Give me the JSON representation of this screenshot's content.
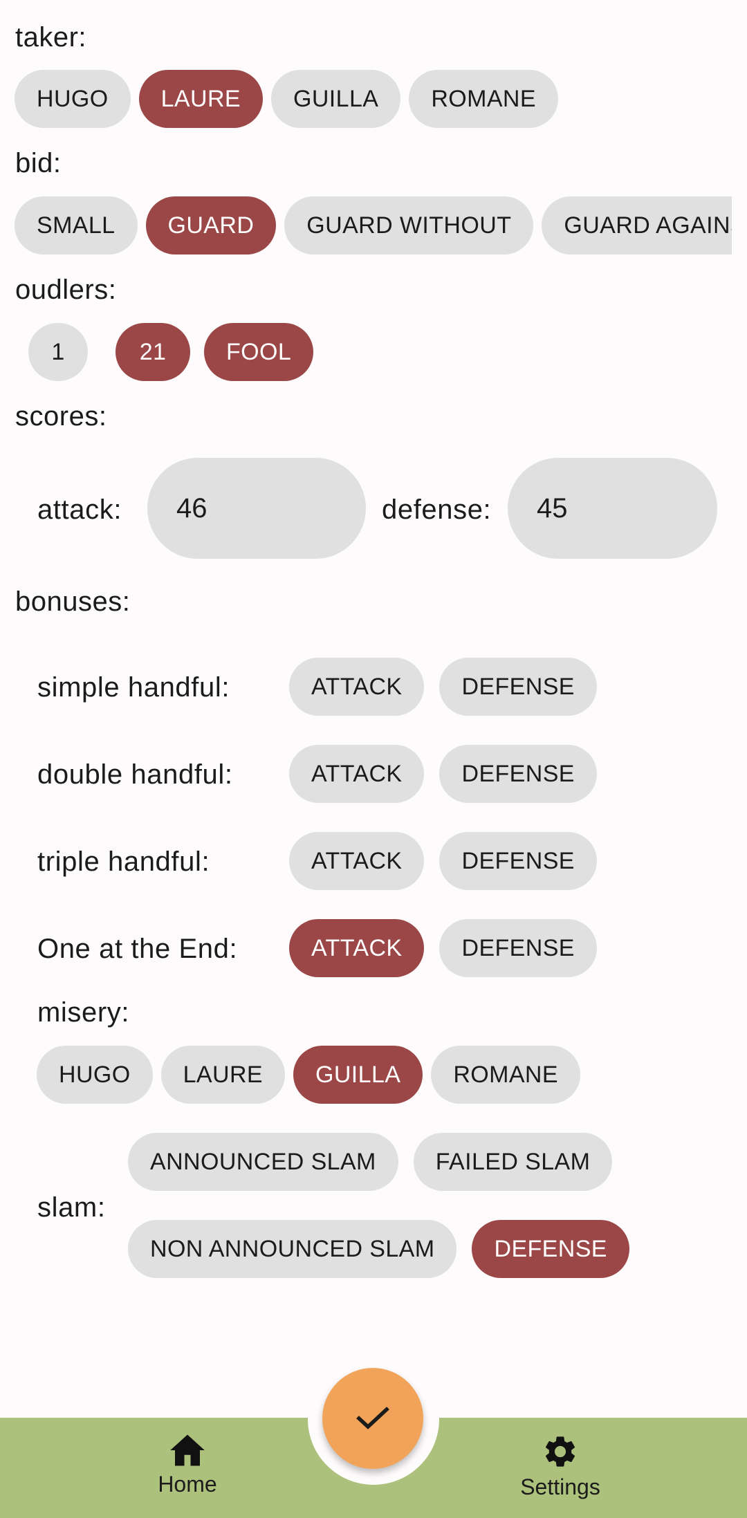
{
  "taker": {
    "label": "taker:",
    "options": [
      "HUGO",
      "LAURE",
      "GUILLA",
      "ROMANE"
    ],
    "selected": "LAURE"
  },
  "bid": {
    "label": "bid:",
    "options": [
      "SMALL",
      "GUARD",
      "GUARD WITHOUT",
      "GUARD AGAINST"
    ],
    "selected": "GUARD"
  },
  "oudlers": {
    "label": "oudlers:",
    "options": [
      "1",
      "21",
      "FOOL"
    ],
    "selected": [
      "21",
      "FOOL"
    ]
  },
  "scores": {
    "label": "scores:",
    "attack_label": "attack:",
    "attack_value": "46",
    "defense_label": "defense:",
    "defense_value": "45"
  },
  "bonuses": {
    "label": "bonuses:",
    "rows": [
      {
        "label": "simple handful:",
        "attack": "ATTACK",
        "defense": "DEFENSE",
        "selected": null
      },
      {
        "label": "double handful:",
        "attack": "ATTACK",
        "defense": "DEFENSE",
        "selected": null
      },
      {
        "label": "triple handful:",
        "attack": "ATTACK",
        "defense": "DEFENSE",
        "selected": null
      },
      {
        "label": "One at the End:",
        "attack": "ATTACK",
        "defense": "DEFENSE",
        "selected": "ATTACK"
      }
    ]
  },
  "misery": {
    "label": "misery:",
    "options": [
      "HUGO",
      "LAURE",
      "GUILLA",
      "ROMANE"
    ],
    "selected": "GUILLA"
  },
  "slam": {
    "label": "slam:",
    "options": [
      "ANNOUNCED SLAM",
      "FAILED SLAM",
      "NON ANNOUNCED SLAM",
      "DEFENSE"
    ],
    "selected": "DEFENSE"
  },
  "fab": {
    "icon": "check-icon"
  },
  "nav": {
    "home_label": "Home",
    "home_icon": "home-icon",
    "settings_label": "Settings",
    "settings_icon": "gear-icon"
  },
  "colors": {
    "selected_chip": "#9b4747",
    "chip": "#e0e0e0",
    "bottom_bar": "#acc17c",
    "fab": "#f2a35a",
    "background": "#fdfbfb"
  }
}
